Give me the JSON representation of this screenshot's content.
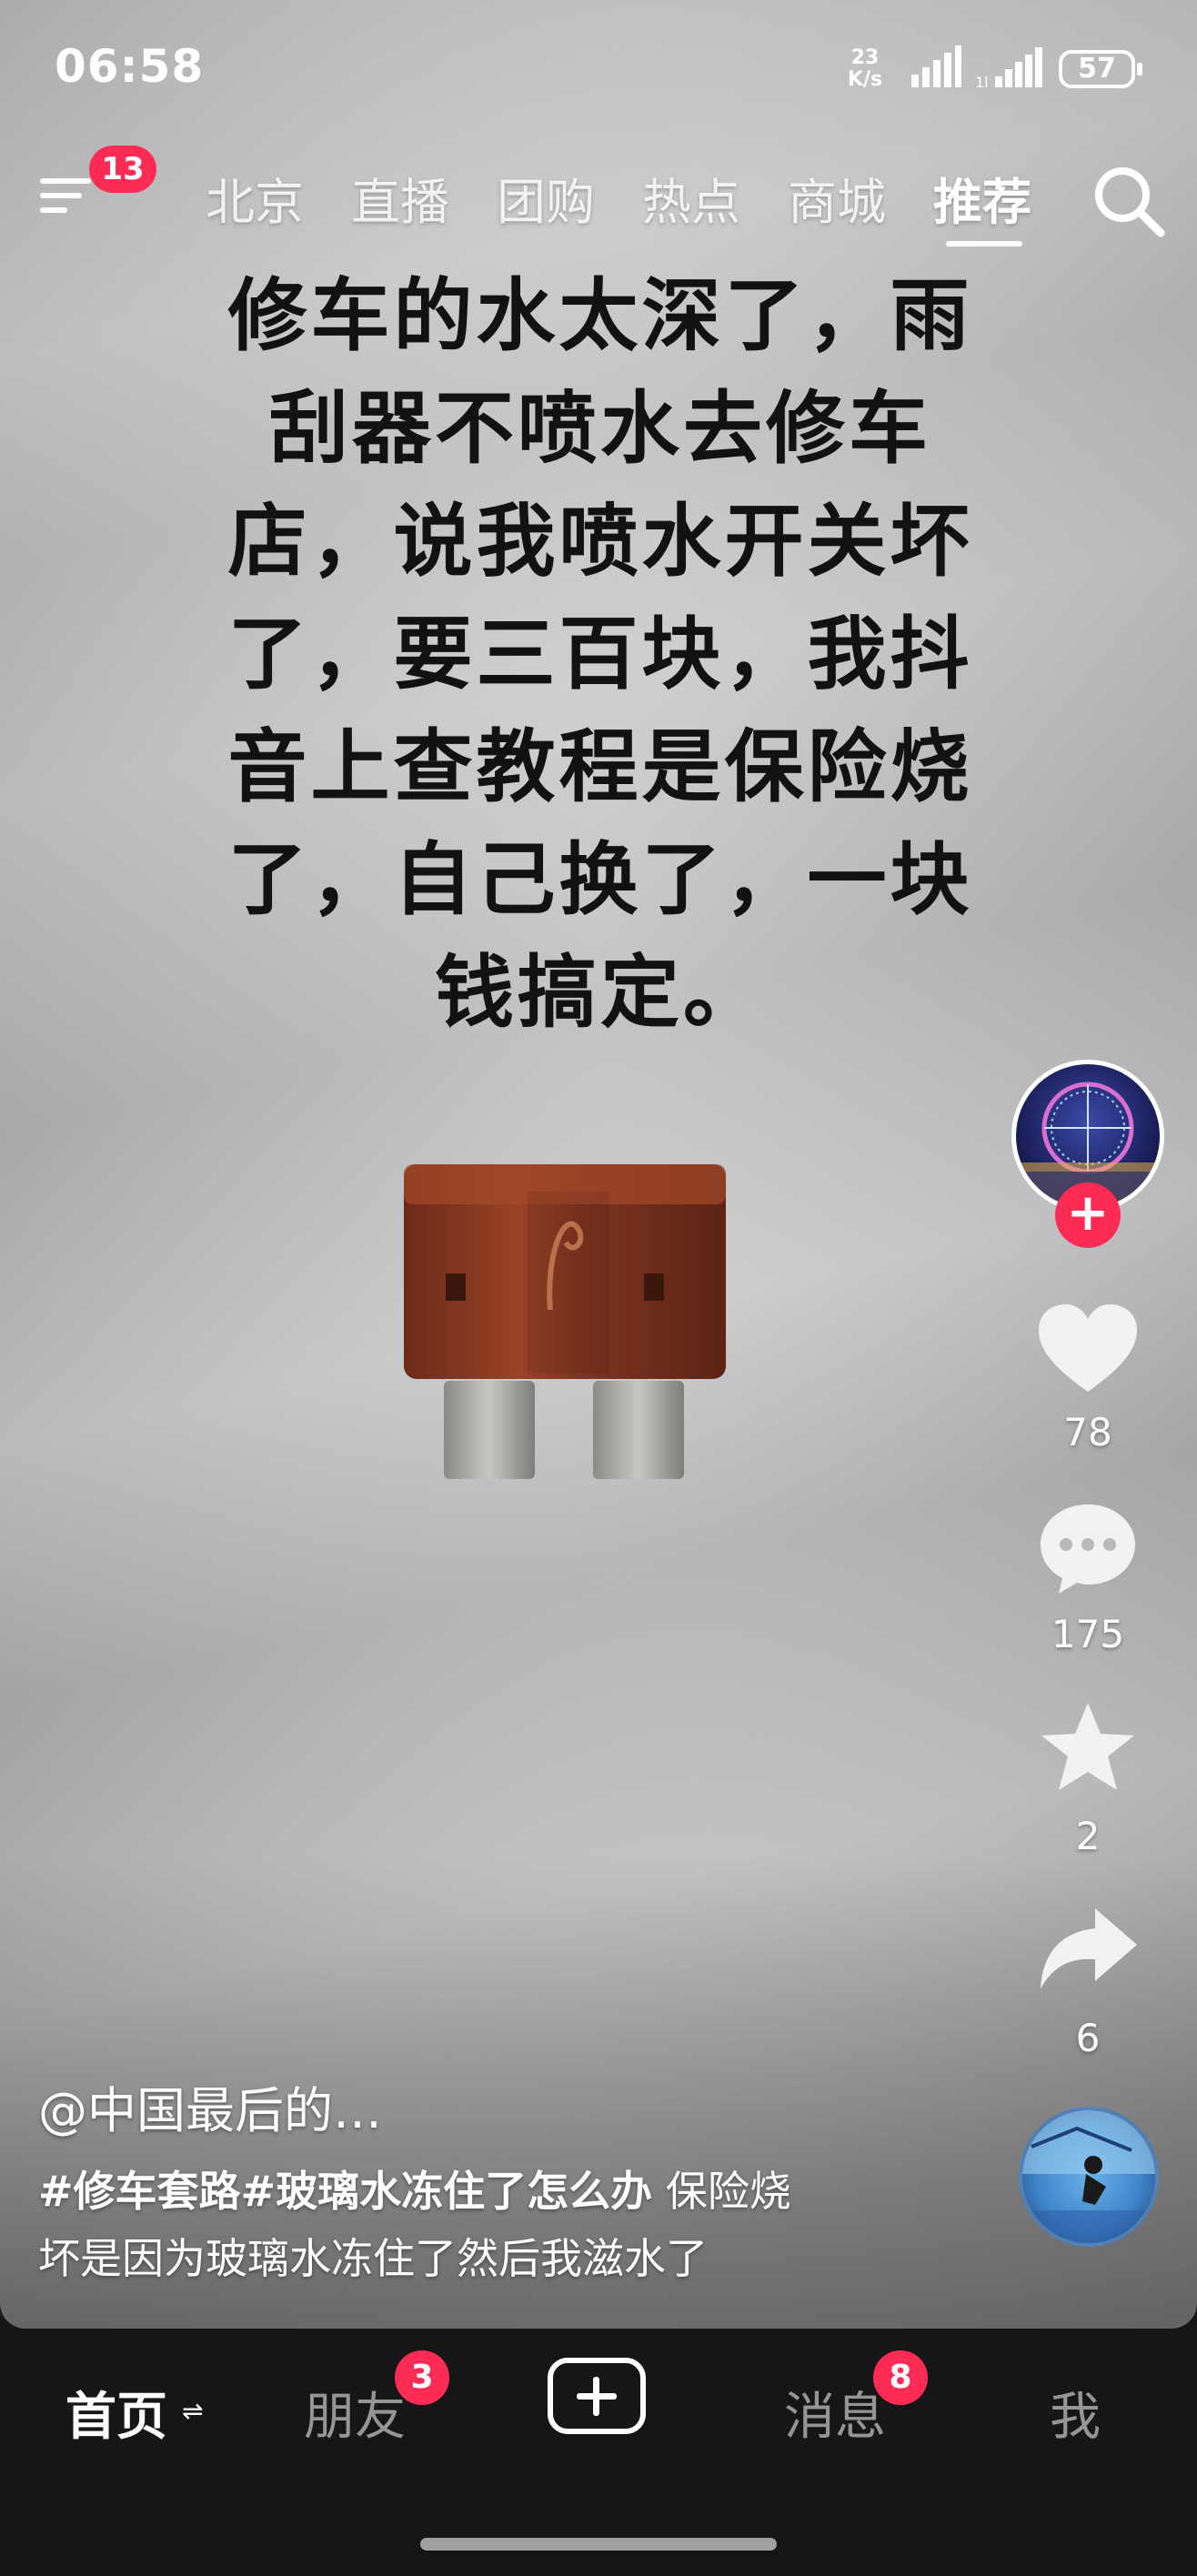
{
  "status_bar": {
    "time": "06:58",
    "net_speed_value": "23",
    "net_speed_unit": "K/s",
    "battery": "57"
  },
  "top_nav": {
    "menu_badge": "13",
    "tabs": [
      "北京",
      "直播",
      "团购",
      "热点",
      "商城",
      "推荐"
    ],
    "active_tab": "推荐"
  },
  "video": {
    "overlay_lines": [
      "修车的水太深了，雨",
      "刮器不喷水去修车",
      "店，说我喷水开关坏",
      "了，要三百块，我抖",
      "音上查教程是保险烧",
      "了，自己换了，一块",
      "钱搞定。"
    ]
  },
  "actions": {
    "likes": "78",
    "comments": "175",
    "favorites": "2",
    "shares": "6"
  },
  "info": {
    "author": "@中国最后的…",
    "hashtags": "#修车套路#玻璃水冻住了怎么办",
    "caption_rest_1": " 保险烧",
    "caption_rest_2": "坏是因为玻璃水冻住了然后我滋水了"
  },
  "bottom_nav": {
    "home": "首页",
    "home_switch": "⇌",
    "friends": "朋友",
    "friends_badge": "3",
    "messages": "消息",
    "messages_badge": "8",
    "me": "我"
  },
  "colors": {
    "accent_red": "#fe2c55",
    "nav_bg": "#161616",
    "fuse_body": "#8b3a22"
  }
}
